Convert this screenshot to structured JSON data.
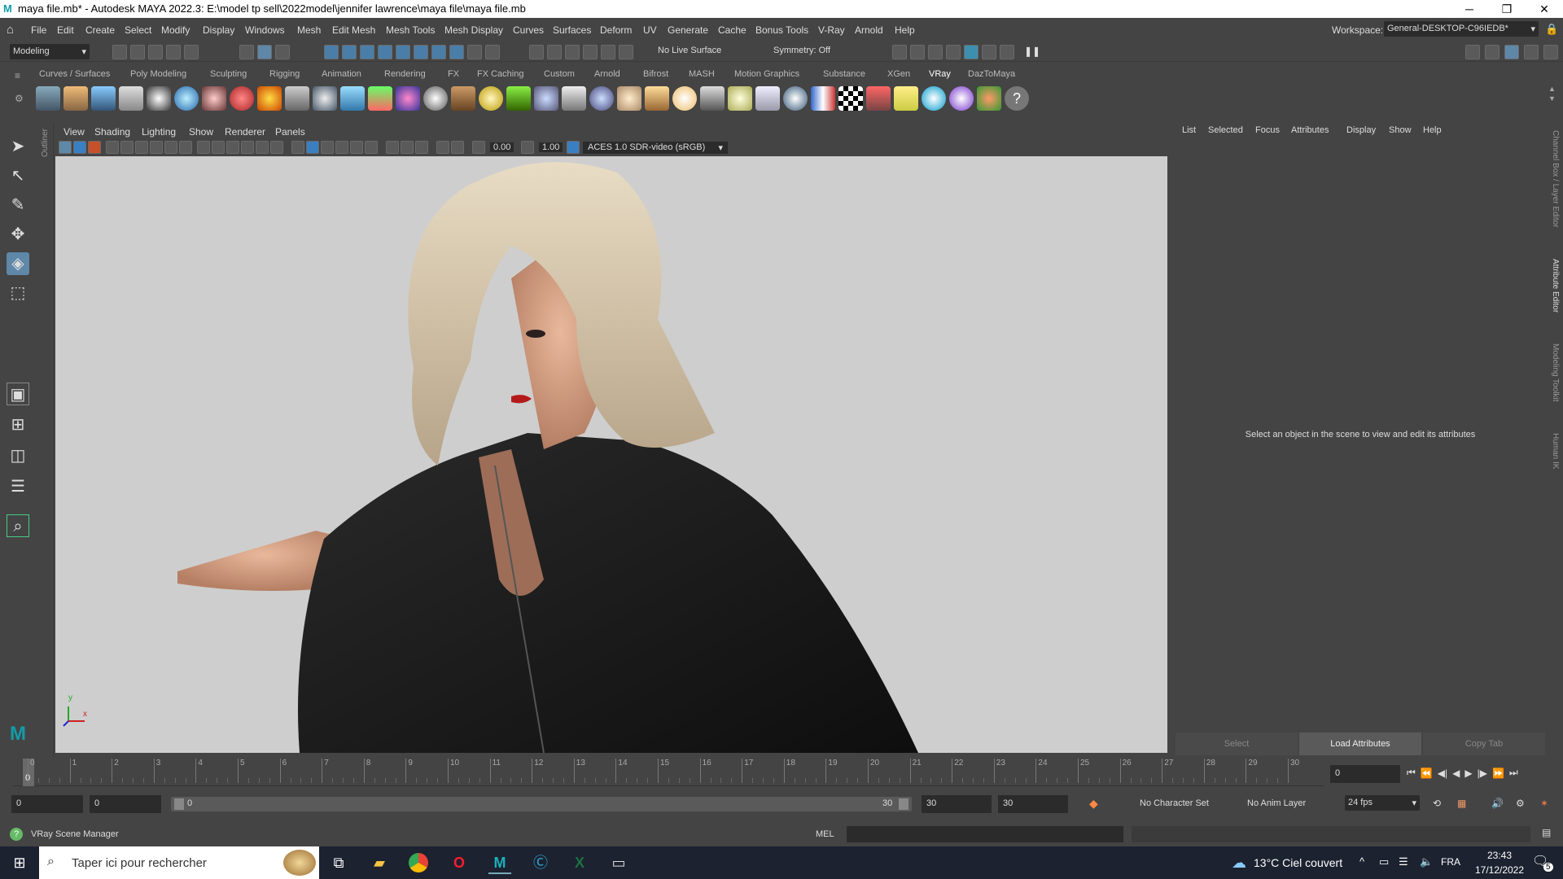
{
  "title_bar": {
    "title": "maya file.mb* - Autodesk MAYA 2022.3: E:\\model tp sell\\2022model\\jennifer lawrence\\maya file\\maya file.mb",
    "minimize": "─",
    "restore": "❐",
    "close": "✕"
  },
  "menu": {
    "items": [
      "File",
      "Edit",
      "Create",
      "Select",
      "Modify",
      "Display",
      "Windows",
      "Mesh",
      "Edit Mesh",
      "Mesh Tools",
      "Mesh Display",
      "Curves",
      "Surfaces",
      "Deform",
      "UV",
      "Generate",
      "Cache",
      "Bonus Tools",
      "V-Ray",
      "Arnold",
      "Help"
    ],
    "workspace_label": "Workspace:",
    "workspace_value": "General-DESKTOP-C96IEDB*"
  },
  "toolbar": {
    "mode": "Modeling",
    "live_surface": "No Live Surface",
    "symmetry": "Symmetry: Off"
  },
  "shelf": {
    "tabs": [
      "Curves / Surfaces",
      "Poly Modeling",
      "Sculpting",
      "Rigging",
      "Animation",
      "Rendering",
      "FX",
      "FX Caching",
      "Custom",
      "Arnold",
      "Bifrost",
      "MASH",
      "Motion Graphics",
      "Substance",
      "XGen",
      "VRay",
      "DazToMaya"
    ],
    "active_tab": "VRay"
  },
  "viewport": {
    "menus": [
      "View",
      "Shading",
      "Lighting",
      "Show",
      "Renderer",
      "Panels"
    ],
    "exposure": "0.00",
    "gamma": "1.00",
    "color_space": "ACES 1.0 SDR-video (sRGB)",
    "axis_y": "y",
    "axis_x": "x"
  },
  "outliner_label": "Outliner",
  "attribute_editor": {
    "menus": [
      "List",
      "Selected",
      "Focus",
      "Attributes",
      "Display",
      "Show",
      "Help"
    ],
    "message": "Select an object in the scene to view and edit its attributes",
    "buttons": [
      "Select",
      "Load Attributes",
      "Copy Tab"
    ]
  },
  "right_strip_labels": [
    "Channel Box / Layer Editor",
    "Attribute Editor",
    "Modeling Toolkit",
    "Human IK"
  ],
  "timeline": {
    "ticks": [
      "0",
      "1",
      "2",
      "3",
      "4",
      "5",
      "6",
      "7",
      "8",
      "9",
      "10",
      "11",
      "12",
      "13",
      "14",
      "15",
      "16",
      "17",
      "18",
      "19",
      "20",
      "21",
      "22",
      "23",
      "24",
      "25",
      "26",
      "27",
      "28",
      "29",
      "30"
    ],
    "current_frame": "0",
    "current_field": "0"
  },
  "range": {
    "start": "0",
    "anim_start": "0",
    "slider_start": "0",
    "slider_end": "30",
    "anim_end": "30",
    "end": "30",
    "character_set": "No Character Set",
    "anim_layer": "No Anim Layer",
    "fps": "24 fps"
  },
  "status": {
    "help_text": "VRay Scene Manager",
    "mel_label": "MEL"
  },
  "taskbar": {
    "search_placeholder": "Taper ici pour rechercher",
    "weather": "13°C  Ciel couvert",
    "lang": "FRA",
    "time": "23:43",
    "date": "17/12/2022",
    "notif_count": "5"
  }
}
